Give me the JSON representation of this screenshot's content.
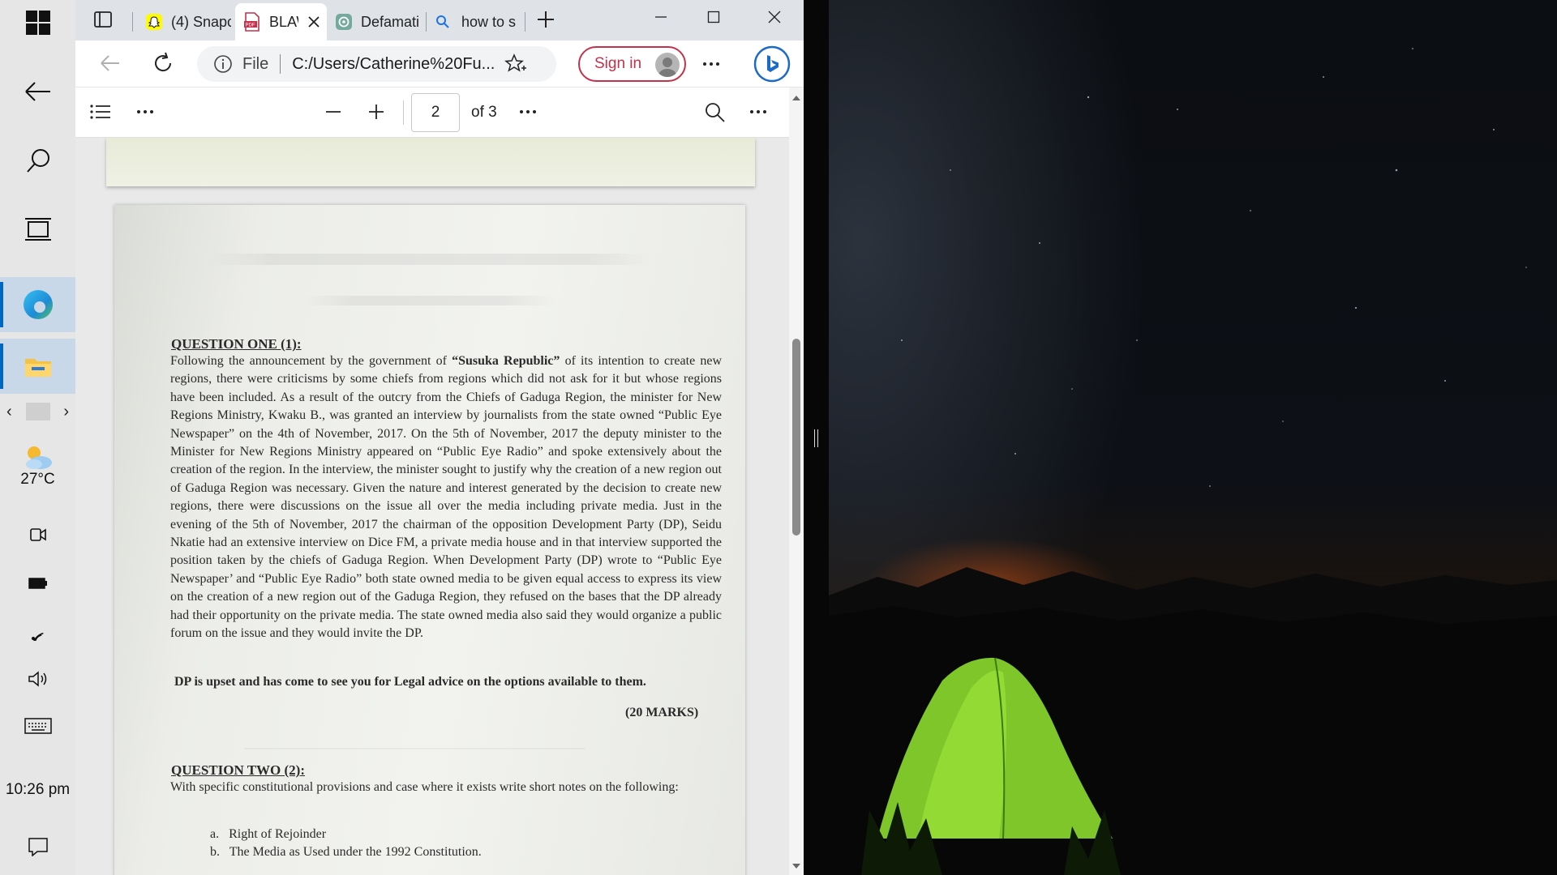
{
  "taskbar": {
    "weather_temp": "27°C",
    "clock": "10:26 pm"
  },
  "browser": {
    "tabs": [
      {
        "label": "(4) Snapc",
        "icon": "snapchat-icon"
      },
      {
        "label": "BLAW",
        "icon": "pdf-icon",
        "active": true
      },
      {
        "label": "Defamati",
        "icon": "chatgpt-icon"
      },
      {
        "label": "how to s",
        "icon": "search-icon"
      }
    ],
    "address": {
      "scheme": "File",
      "url": "C:/Users/Catherine%20Fu..."
    },
    "signin_label": "Sign in"
  },
  "pdf_toolbar": {
    "current_page": "2",
    "total_pages": "of 3"
  },
  "document": {
    "q1_heading": "QUESTION ONE (1):",
    "q1_text_a": "Following the announcement by the government of ",
    "q1_bold_name": "“Susuka Republic”",
    "q1_text_b": " of its intention to create new regions, there were criticisms by some chiefs from regions which did not ask for it but whose regions have been included. As a result of the outcry from the Chiefs of Gaduga Region, the minister for New Regions Ministry, Kwaku B., was granted an interview by journalists from the state owned “Public Eye Newspaper” on the 4th of November, 2017. On the 5th of November, 2017 the deputy minister to the Minister for New Regions Ministry appeared on “Public Eye Radio” and spoke extensively about the creation of the region. In the interview, the minister sought to justify why the creation of a new region out of Gaduga Region was necessary. Given the nature and interest generated by the decision to create new regions, there were discussions on the issue all over the media including private media. Just in the evening of the 5th of November, 2017 the chairman of the opposition Development Party (DP), Seidu Nkatie had an extensive interview on Dice FM, a private media house and in that interview supported the position taken by the chiefs of Gaduga Region. When Development Party (DP) wrote to “Public Eye Newspaper’ and “Public Eye Radio” both state owned media to be given equal access to express its view on the creation of a new region out of the Gaduga Region, they refused on the bases that the DP already had their opportunity on the private media. The state owned media also said they would organize a public forum on the issue and they would invite the DP.",
    "q1_task": "DP is upset and has come to see you for Legal advice on the options available to them.",
    "q1_marks": "(20 MARKS)",
    "q2_heading": "QUESTION TWO (2):",
    "q2_text": "With specific constitutional provisions and case where it exists write short notes on the following:",
    "q2_items": [
      {
        "marker": "a.",
        "text": "Right of Rejoinder"
      },
      {
        "marker": "b.",
        "text": "The Media as Used under the 1992 Constitution."
      }
    ]
  }
}
